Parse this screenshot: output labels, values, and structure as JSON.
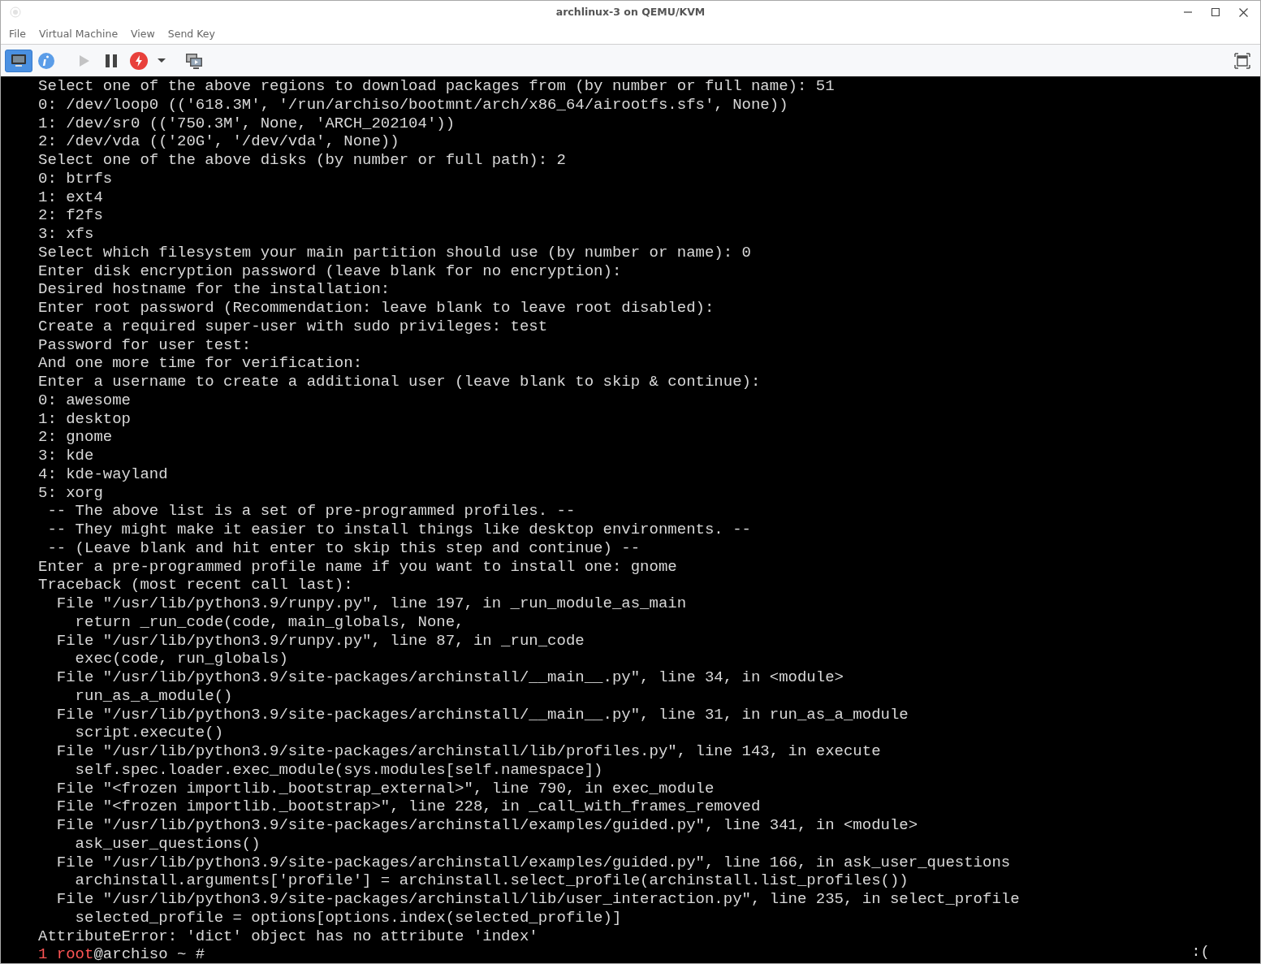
{
  "window": {
    "title": "archlinux-3 on QEMU/KVM"
  },
  "menu": [
    "File",
    "Virtual Machine",
    "View",
    "Send Key"
  ],
  "toolbar": [
    {
      "kind": "console",
      "selected": true
    },
    {
      "kind": "details",
      "selected": false
    },
    {
      "kind": "run",
      "disabled": true
    },
    {
      "kind": "pause",
      "disabled": false
    },
    {
      "kind": "shutdown",
      "disabled": false
    },
    {
      "kind": "menu-caret",
      "disabled": false
    },
    {
      "kind": "snapshots",
      "disabled": false
    }
  ],
  "toolbar_right": [
    {
      "kind": "fullscreen"
    }
  ],
  "terminal": {
    "lines": [
      "Select one of the above regions to download packages from (by number or full name): 51",
      "0: /dev/loop0 (('618.3M', '/run/archiso/bootmnt/arch/x86_64/airootfs.sfs', None))",
      "1: /dev/sr0 (('750.3M', None, 'ARCH_202104'))",
      "2: /dev/vda (('20G', '/dev/vda', None))",
      "Select one of the above disks (by number or full path): 2",
      "0: btrfs",
      "1: ext4",
      "2: f2fs",
      "3: xfs",
      "Select which filesystem your main partition should use (by number or name): 0",
      "Enter disk encryption password (leave blank for no encryption):",
      "Desired hostname for the installation:",
      "Enter root password (Recommendation: leave blank to leave root disabled):",
      "Create a required super-user with sudo privileges: test",
      "Password for user test:",
      "And one more time for verification:",
      "Enter a username to create a additional user (leave blank to skip & continue):",
      "0: awesome",
      "1: desktop",
      "2: gnome",
      "3: kde",
      "4: kde-wayland",
      "5: xorg",
      " -- The above list is a set of pre-programmed profiles. --",
      " -- They might make it easier to install things like desktop environments. --",
      " -- (Leave blank and hit enter to skip this step and continue) --",
      "Enter a pre-programmed profile name if you want to install one: gnome",
      "Traceback (most recent call last):",
      "  File \"/usr/lib/python3.9/runpy.py\", line 197, in _run_module_as_main",
      "    return _run_code(code, main_globals, None,",
      "  File \"/usr/lib/python3.9/runpy.py\", line 87, in _run_code",
      "    exec(code, run_globals)",
      "  File \"/usr/lib/python3.9/site-packages/archinstall/__main__.py\", line 34, in <module>",
      "    run_as_a_module()",
      "  File \"/usr/lib/python3.9/site-packages/archinstall/__main__.py\", line 31, in run_as_a_module",
      "    script.execute()",
      "  File \"/usr/lib/python3.9/site-packages/archinstall/lib/profiles.py\", line 143, in execute",
      "    self.spec.loader.exec_module(sys.modules[self.namespace])",
      "  File \"<frozen importlib._bootstrap_external>\", line 790, in exec_module",
      "  File \"<frozen importlib._bootstrap>\", line 228, in _call_with_frames_removed",
      "  File \"/usr/lib/python3.9/site-packages/archinstall/examples/guided.py\", line 341, in <module>",
      "    ask_user_questions()",
      "  File \"/usr/lib/python3.9/site-packages/archinstall/examples/guided.py\", line 166, in ask_user_questions",
      "    archinstall.arguments['profile'] = archinstall.select_profile(archinstall.list_profiles())",
      "  File \"/usr/lib/python3.9/site-packages/archinstall/lib/user_interaction.py\", line 235, in select_profile",
      "    selected_profile = options[options.index(selected_profile)]",
      "AttributeError: 'dict' object has no attribute 'index'"
    ],
    "prompt": {
      "status": "1",
      "user": "root",
      "host": "@archiso",
      "path": "~",
      "symbol": "#"
    },
    "indicator": ":("
  }
}
